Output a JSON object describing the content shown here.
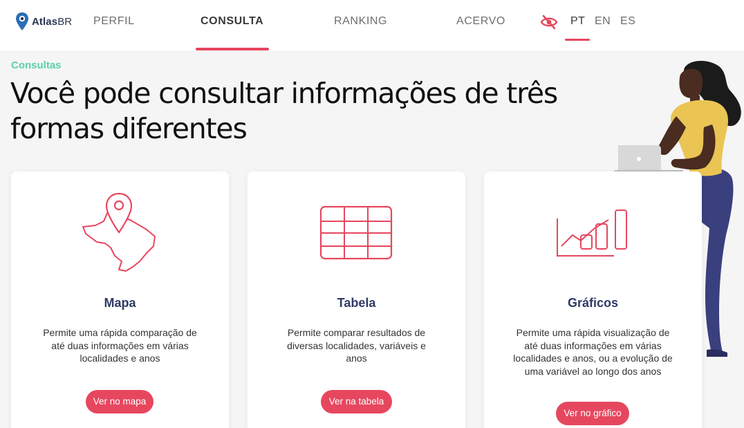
{
  "header": {
    "logo": {
      "bold": "Atlas",
      "light": "BR"
    },
    "nav": [
      {
        "label": "PERFIL"
      },
      {
        "label": "CONSULTA"
      },
      {
        "label": "RANKING"
      },
      {
        "label": "ACERVO"
      }
    ],
    "active_nav": "CONSULTA",
    "languages": [
      {
        "label": "PT"
      },
      {
        "label": "EN"
      },
      {
        "label": "ES"
      }
    ],
    "active_language": "PT",
    "accessibility_icon": "eye-slash-icon"
  },
  "section": {
    "label": "Consultas",
    "headline": "Você pode consultar informações de três formas diferentes"
  },
  "cards": [
    {
      "icon": "brazil-map-pin-icon",
      "title": "Mapa",
      "description": "Permite uma rápida comparação de até duas informações em várias localidades e anos",
      "button": "Ver no mapa"
    },
    {
      "icon": "table-icon",
      "title": "Tabela",
      "description": "Permite comparar resultados de diversas localidades, variáveis e anos",
      "button": "Ver na tabela"
    },
    {
      "icon": "chart-icon",
      "title": "Gráficos",
      "description": "Permite uma rápida visualização de até duas informações em várias localidades e anos, ou a evolução de uma variável ao longo dos anos",
      "button": "Ver no gráfico"
    }
  ],
  "colors": {
    "accent": "#e6475f",
    "section_label": "#5bd1a8",
    "card_title": "#2f3a66",
    "navy": "#2a3352",
    "illustration_shirt": "#ebc553",
    "illustration_pants": "#3a3f7e"
  }
}
